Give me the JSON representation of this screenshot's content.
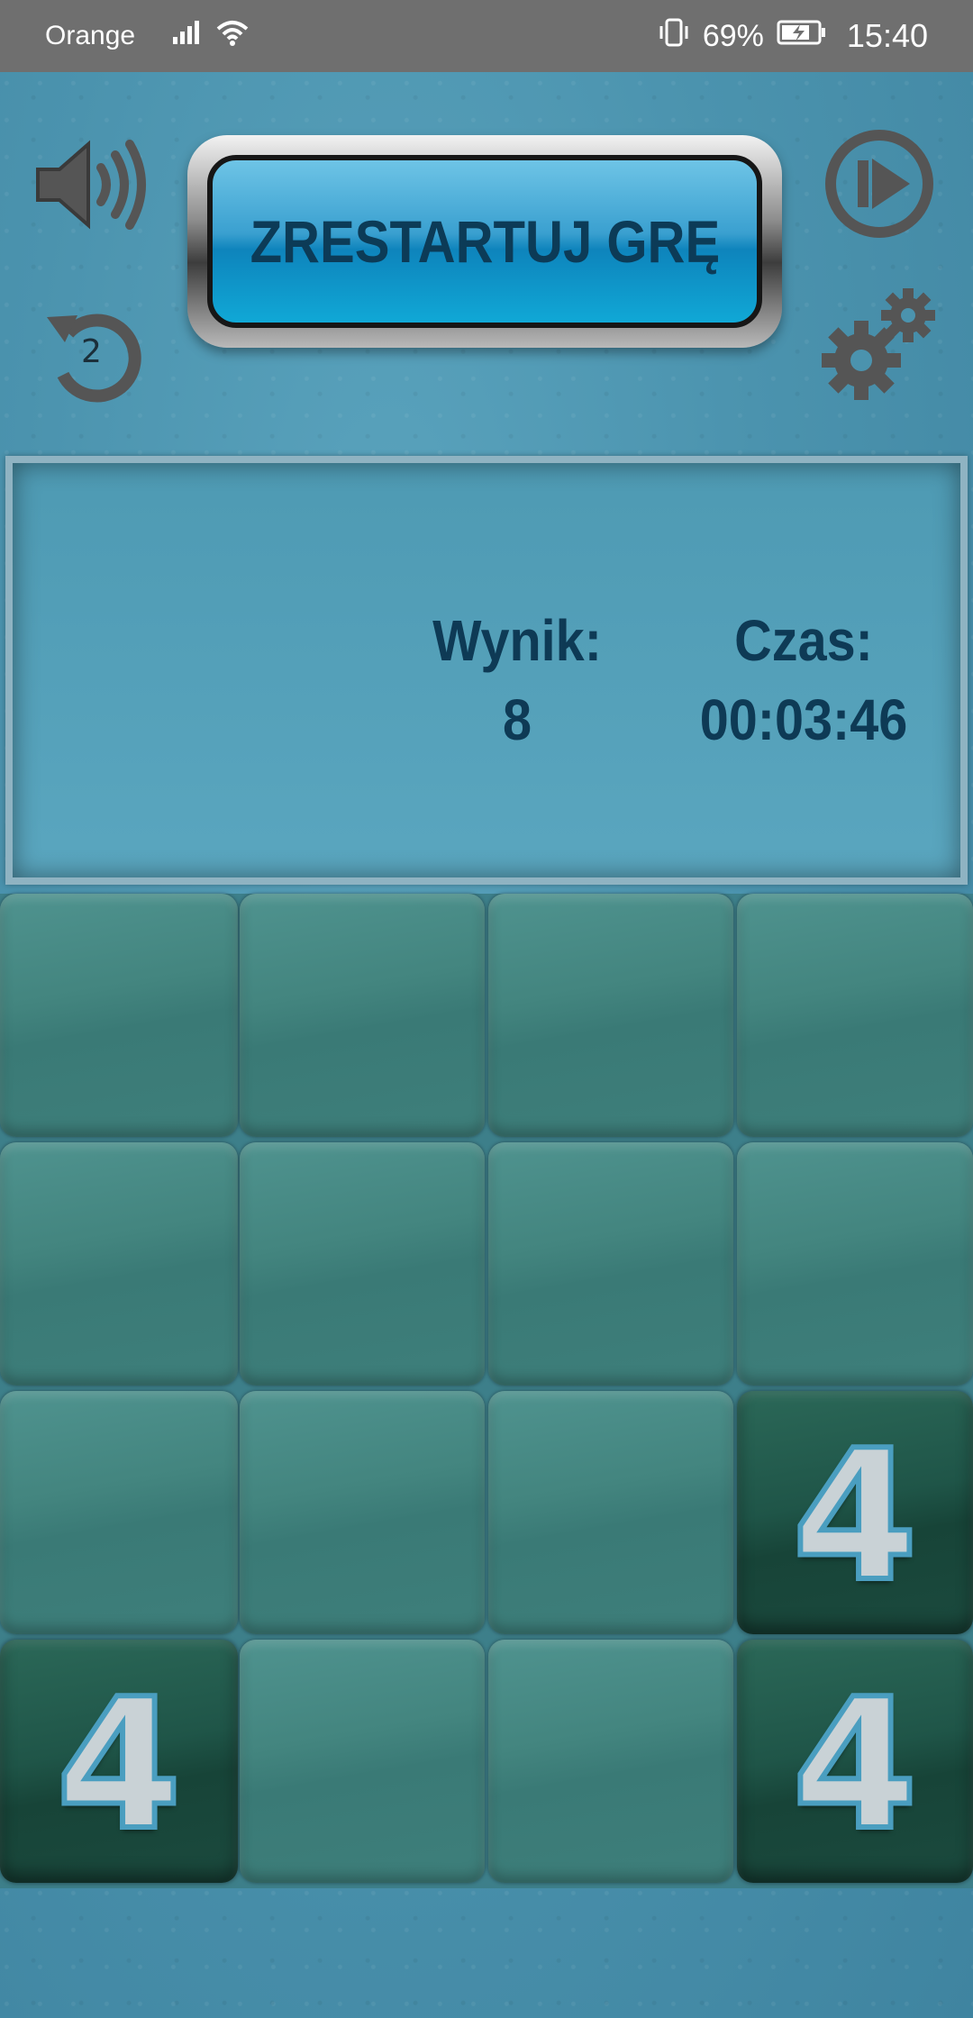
{
  "status_bar": {
    "carrier": "Orange",
    "battery": "69%",
    "time": "15:40"
  },
  "controls": {
    "restart_label": "ZRESTARTUJ GRĘ",
    "undo_count": "2",
    "sound_icon": "speaker-icon",
    "undo_icon": "undo-icon",
    "play_icon": "play-icon",
    "settings_icon": "gears-icon"
  },
  "stats": {
    "score_label": "Wynik:",
    "score_value": "8",
    "time_label": "Czas:",
    "time_value": "00:03:46"
  },
  "board": {
    "size": 4,
    "cells": [
      [
        "",
        "",
        "",
        ""
      ],
      [
        "",
        "",
        "",
        ""
      ],
      [
        "",
        "",
        "",
        "4"
      ],
      [
        "4",
        "",
        "",
        "4"
      ]
    ]
  },
  "colors": {
    "background": "#4b93ae",
    "tile_empty": "#43857f",
    "tile_filled": "#1f5548",
    "text_dark": "#0e3a55"
  }
}
